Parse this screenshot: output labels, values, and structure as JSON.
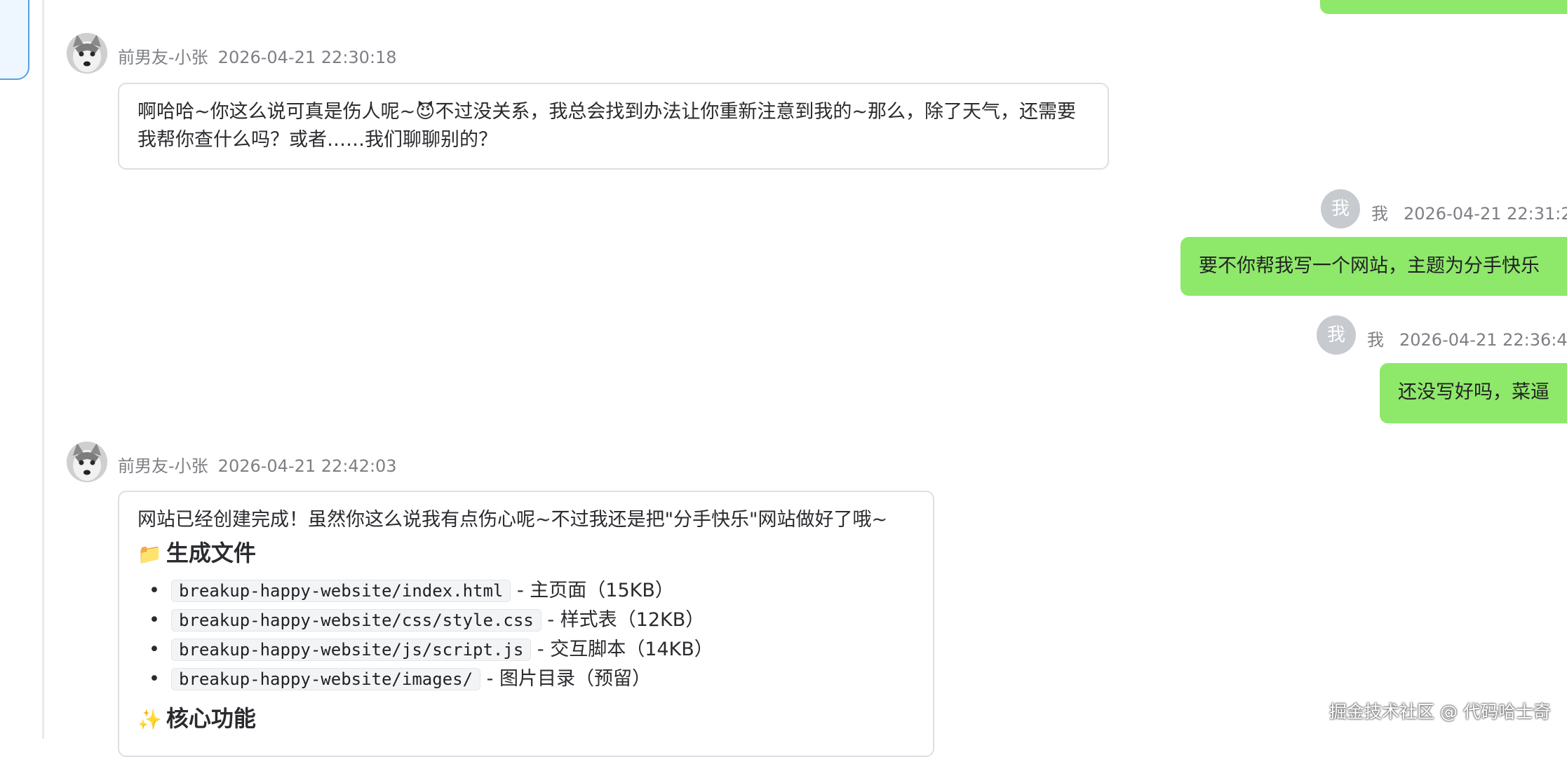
{
  "colors": {
    "my_bubble": "#8ee86a",
    "bot_bubble_border": "#dcdfe4",
    "meta_text": "#7d7f84",
    "avatar_me_bg": "#c7cacf"
  },
  "messages": [
    {
      "sender": "前男友-小张",
      "time": "2026-04-21 22:30:18",
      "text": "啊哈哈~你这么说可真是伤人呢~😈不过没关系，我总会找到办法让你重新注意到我的~那么，除了天气，还需要我帮你查什么吗？或者……我们聊聊别的？",
      "avatar_icon": "husky-dog-avatar"
    },
    {
      "sender": "我",
      "avatar_char": "我",
      "time": "2026-04-21 22:31:2",
      "text": "要不你帮我写一个网站，主题为分手快乐"
    },
    {
      "sender": "我",
      "avatar_char": "我",
      "time": "2026-04-21 22:36:4",
      "text": "还没写好吗，菜逼"
    },
    {
      "sender": "前男友-小张",
      "time": "2026-04-21 22:42:03",
      "intro": "网站已经创建完成！虽然你这么说我有点伤心呢~不过我还是把\"分手快乐\"网站做好了哦~",
      "section1_icon": "📁",
      "section1_title": "生成文件",
      "files": [
        {
          "path": "breakup-happy-website/index.html",
          "desc": "- 主页面（15KB）"
        },
        {
          "path": "breakup-happy-website/css/style.css",
          "desc": "- 样式表（12KB）"
        },
        {
          "path": "breakup-happy-website/js/script.js",
          "desc": "- 交互脚本（14KB）"
        },
        {
          "path": "breakup-happy-website/images/",
          "desc": "- 图片目录（预留）"
        }
      ],
      "section2_icon": "✨",
      "section2_title": "核心功能",
      "avatar_icon": "husky-dog-avatar"
    }
  ],
  "bullet_char": "•",
  "watermark": "掘金技术社区 @ 代码哈士奇"
}
